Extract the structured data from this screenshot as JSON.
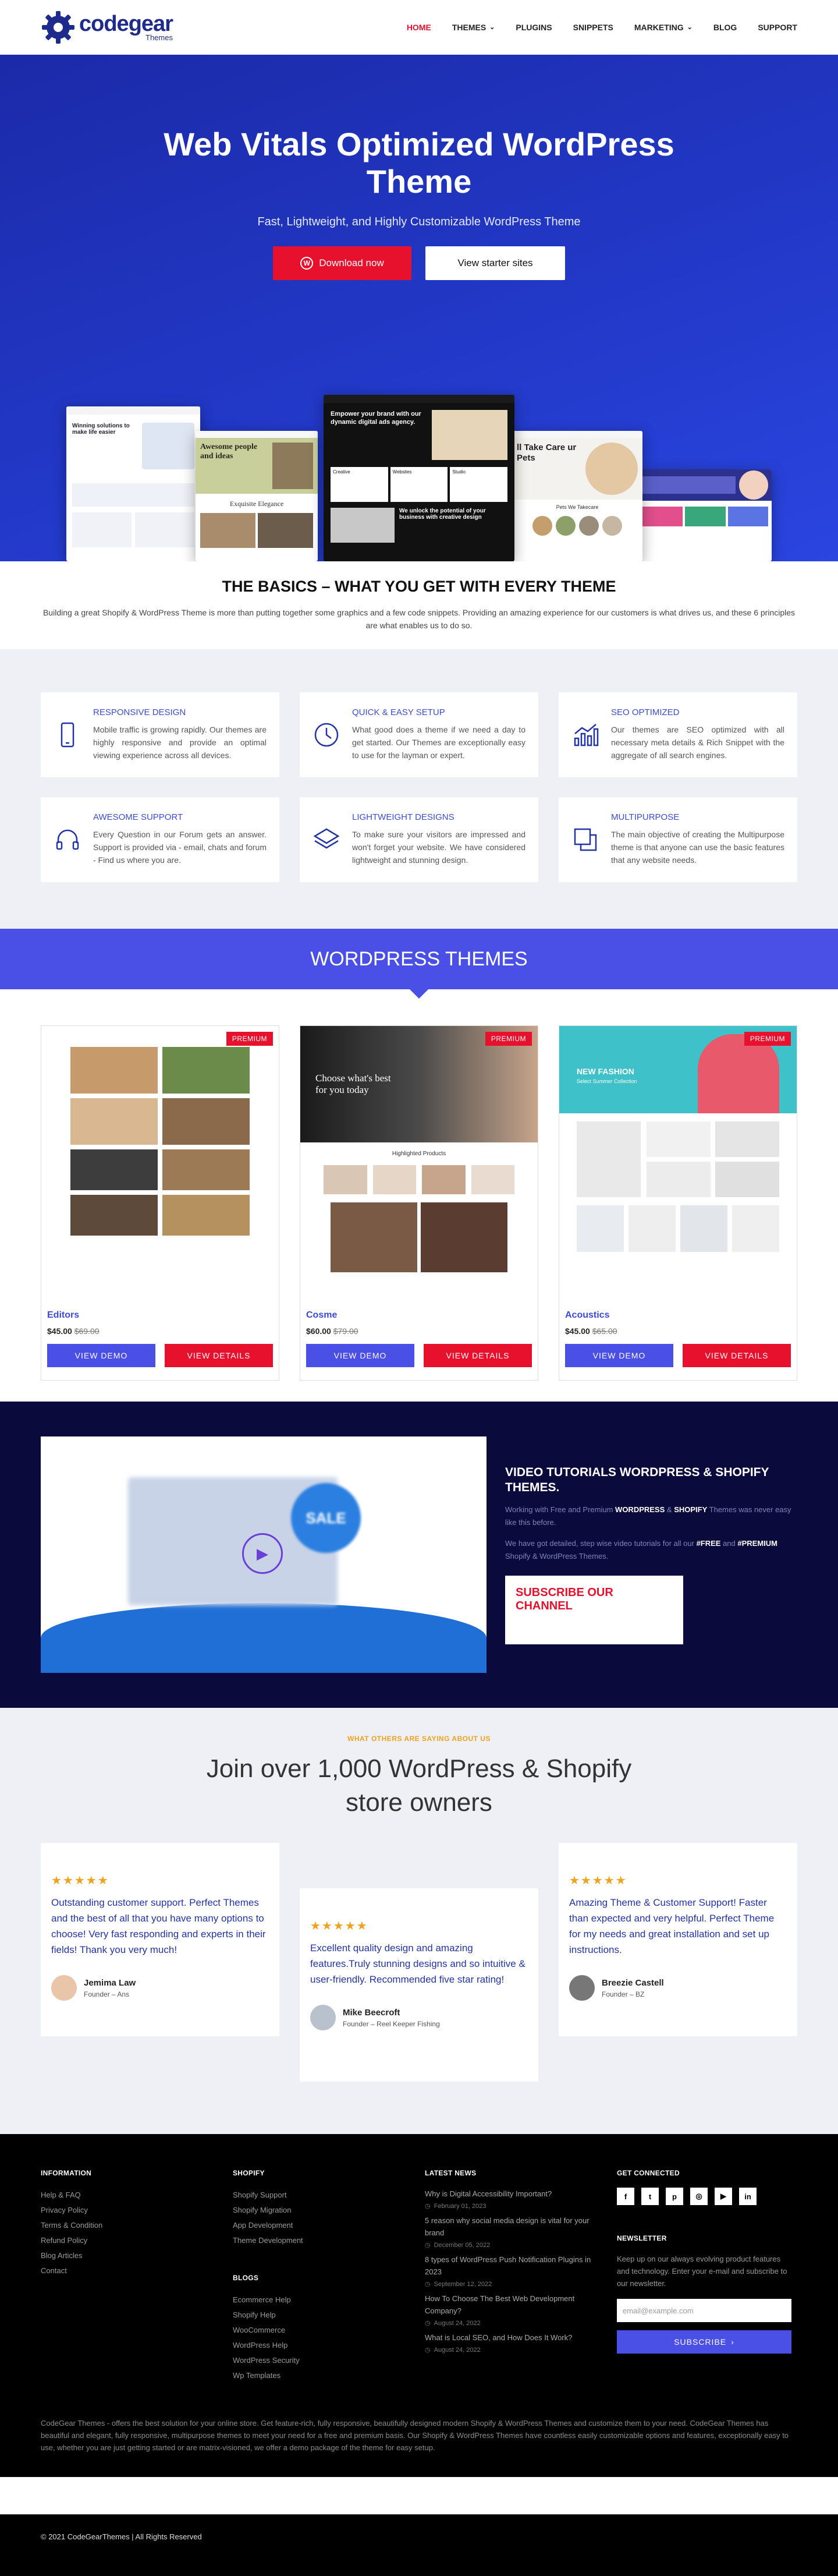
{
  "header": {
    "logo_text": "codegear",
    "logo_sub": "Themes",
    "nav": [
      {
        "label": "HOME",
        "active": true,
        "dropdown": false
      },
      {
        "label": "THEMES",
        "active": false,
        "dropdown": true
      },
      {
        "label": "PLUGINS",
        "active": false,
        "dropdown": false
      },
      {
        "label": "SNIPPETS",
        "active": false,
        "dropdown": false
      },
      {
        "label": "MARKETING",
        "active": false,
        "dropdown": true
      },
      {
        "label": "BLOG",
        "active": false,
        "dropdown": false
      },
      {
        "label": "SUPPORT",
        "active": false,
        "dropdown": false
      }
    ]
  },
  "hero": {
    "title": "Web Vitals Optimized WordPress Theme",
    "subtitle": "Fast, Lightweight, and Highly Customizable WordPress Theme",
    "download_label": "Download now",
    "starter_label": "View starter sites",
    "mock1_title": "Awesome people and ideas",
    "mock1_sub": "Exquisite Elegance",
    "mock2_title": "Empower your brand with our dynamic digital ads agency.",
    "mock2_sub": "We unlock the potential of your business with creative design",
    "mock2_cols": [
      "Creative",
      "Websites",
      "Studio"
    ],
    "mock3_title": "ll Take Care ur Pets",
    "mock3_sub": "Pets We Takecare",
    "mock0_title": "Winning solutions to make life easier"
  },
  "basics": {
    "title": "THE BASICS – WHAT YOU GET WITH EVERY THEME",
    "text": "Building a great Shopify & WordPress Theme is more than putting together some graphics and a few code snippets. Providing an amazing experience for our customers is what drives us, and these 6 principles are what enables us to do so."
  },
  "features": [
    {
      "icon": "mobile-icon",
      "title": "RESPONSIVE DESIGN",
      "text": "Mobile traffic is growing rapidly. Our themes are highly responsive and provide an optimal viewing experience across all devices."
    },
    {
      "icon": "clock-icon",
      "title": "QUICK & EASY SETUP",
      "text": "What good does a theme if we need a day to get started. Our Themes are exceptionally easy to use for the layman or expert."
    },
    {
      "icon": "chart-icon",
      "title": "SEO OPTIMIZED",
      "text": "Our themes are SEO optimized with all necessary meta details & Rich Snippet with the aggregate of all search engines."
    },
    {
      "icon": "headphones-icon",
      "title": "AWESOME SUPPORT",
      "text": "Every Question in our Forum gets an answer. Support is provided via - email, chats and forum - Find us where you are."
    },
    {
      "icon": "layers-icon",
      "title": "LIGHTWEIGHT DESIGNS",
      "text": "To make sure your visitors are impressed and won't forget your website. We have considered lightweight and stunning design."
    },
    {
      "icon": "multipurpose-icon",
      "title": "MULTIPURPOSE",
      "text": "The main objective of creating the Multipurpose theme is that anyone can use the basic features that any website needs."
    }
  ],
  "themes_section": {
    "title": "WORDPRESS THEMES"
  },
  "themes": [
    {
      "name": "Editors",
      "price": "$45.00",
      "old_price": "$69.00",
      "badge": "PREMIUM",
      "demo": "VIEW DEMO",
      "details": "VIEW DETAILS"
    },
    {
      "name": "Cosme",
      "price": "$60.00",
      "old_price": "$79.00",
      "badge": "PREMIUM",
      "demo": "VIEW DEMO",
      "details": "VIEW DETAILS",
      "thumb_text": "Choose what's best for you today",
      "thumb_sub": "Highlighted Products"
    },
    {
      "name": "Acoustics",
      "price": "$45.00",
      "old_price": "$65.00",
      "badge": "PREMIUM",
      "demo": "VIEW DEMO",
      "details": "VIEW DETAILS",
      "thumb_text": "NEW FASHION",
      "thumb_sub": "Select Summer Collection"
    }
  ],
  "video": {
    "title": "VIDEO TUTORIALS WORDPRESS & SHOPIFY THEMES.",
    "p1_a": "Working with Free and Premium ",
    "p1_b": "WORDPRESS",
    "p1_c": " & ",
    "p1_d": "SHOPIFY",
    "p1_e": " Themes was never easy like this before.",
    "p2_a": "We have got detailed, step wise video tutorials for all our ",
    "p2_b": "#FREE",
    "p2_c": " and ",
    "p2_d": "#PREMIUM",
    "p2_e": " Shopify & WordPress Themes.",
    "subscribe": "SUBSCRIBE OUR CHANNEL",
    "sale": "SALE"
  },
  "testimonials_section": {
    "kicker": "WHAT OTHERS ARE SAYING ABOUT US",
    "title": "Join over 1,000 WordPress & Shopify store owners"
  },
  "testimonials": [
    {
      "stars": "★★★★★",
      "text": "Outstanding customer support. Perfect Themes and the best of all that you have many options to choose! Very fast responding and experts in their fields! Thank you very much!",
      "name": "Jemima Law",
      "role": "Founder – Ans"
    },
    {
      "stars": "★★★★★",
      "text": "Excellent quality design and amazing features.Truly stunning designs and so intuitive & user-friendly. Recommended five star rating!",
      "name": "Mike Beecroft",
      "role": "Founder – Reel Keeper Fishing"
    },
    {
      "stars": "★★★★★",
      "text": "Amazing Theme & Customer Support! Faster than expected and very helpful. Perfect Theme for my needs and great installation and set up instructions.",
      "name": "Breezie Castell",
      "role": "Founder – BZ"
    }
  ],
  "footer": {
    "info_title": "INFORMATION",
    "info": [
      "Help & FAQ",
      "Privacy Policy",
      "Terms & Condition",
      "Refund Policy",
      "Blog Articles",
      "Contact"
    ],
    "shopify_title": "SHOPIFY",
    "shopify": [
      "Shopify Support",
      "Shopify Migration",
      "App Development",
      "Theme Development"
    ],
    "blogs_title": "BLOGS",
    "blogs": [
      "Ecommerce Help",
      "Shopify Help",
      "WooCommerce",
      "WordPress Help",
      "WordPress Security",
      "Wp Templates"
    ],
    "news_title": "LATEST NEWS",
    "news": [
      {
        "title": "Why is Digital Accessibility Important?",
        "date": "February 01, 2023"
      },
      {
        "title": "5 reason why social media design is vital for your brand",
        "date": "December 05, 2022"
      },
      {
        "title": "8 types of WordPress Push Notification Plugins in 2023",
        "date": "September 12, 2022"
      },
      {
        "title": "How To Choose The Best Web Development Company?",
        "date": "August 24, 2022"
      },
      {
        "title": "What is Local SEO, and How Does It Work?",
        "date": "August 24, 2022"
      }
    ],
    "connected_title": "GET CONNECTED",
    "social": [
      {
        "icon": "facebook-icon",
        "glyph": "f"
      },
      {
        "icon": "twitter-icon",
        "glyph": "t"
      },
      {
        "icon": "pinterest-icon",
        "glyph": "p"
      },
      {
        "icon": "instagram-icon",
        "glyph": "◎"
      },
      {
        "icon": "youtube-icon",
        "glyph": "▶"
      },
      {
        "icon": "linkedin-icon",
        "glyph": "in"
      }
    ],
    "newsletter_title": "NEWSLETTER",
    "newsletter_text": "Keep up on our always evolving product features and technology. Enter your e-mail and subscribe to our newsletter.",
    "email_placeholder": "email@example.com",
    "subscribe_label": "SUBSCRIBE",
    "about": "CodeGear Themes - offers the best solution for your online store. Get feature-rich, fully responsive, beautifully designed modern Shopify & WordPress Themes and customize them to your need. CodeGear Themes has beautiful and elegant, fully responsive, multipurpose themes to meet your need for a free and premium basis. Our Shopify & WordPress Themes have countless easily customizable options and features, exceptionally easy to use, whether you are just getting started or are matrix-visioned, we offer a demo package of the theme for easy setup.",
    "copyright": "© 2021 CodeGearThemes | All Rights Reserved"
  }
}
